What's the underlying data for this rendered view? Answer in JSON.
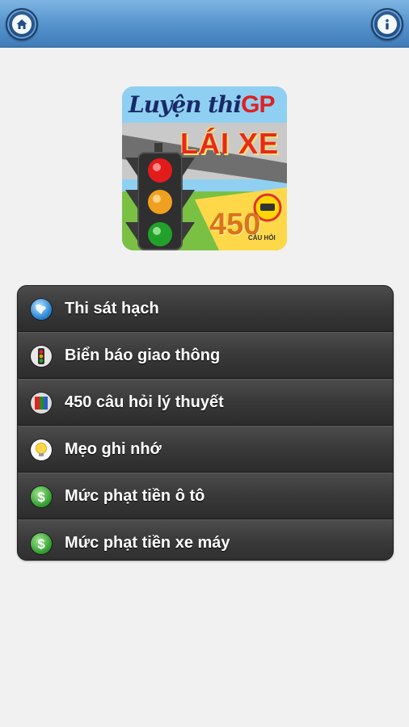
{
  "header": {
    "home_icon": "home-icon",
    "info_icon": "info-icon"
  },
  "logo": {
    "line1": "Luyện thi",
    "line1_accent": "GP",
    "line2": "LÁI XE",
    "number": "450",
    "small": "CÂU HỎI"
  },
  "menu": {
    "items": [
      {
        "label": "Thi sát hạch",
        "icon": "globe-icon"
      },
      {
        "label": "Biển báo giao thông",
        "icon": "traffic-light-icon"
      },
      {
        "label": "450 câu hỏi lý thuyết",
        "icon": "book-icon"
      },
      {
        "label": "Mẹo ghi nhớ",
        "icon": "lightbulb-icon"
      },
      {
        "label": "Mức phạt tiền ô tô",
        "icon": "money-icon"
      },
      {
        "label": "Mức phạt tiền xe máy",
        "icon": "money-icon"
      }
    ]
  },
  "colors": {
    "header_top": "#7fb5e3",
    "header_bottom": "#3f7bb9",
    "menu_bg": "#3a3a3a",
    "page_bg": "#f1f1f1"
  }
}
